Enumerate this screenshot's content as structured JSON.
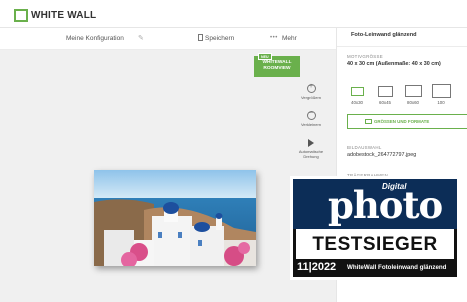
{
  "header": {
    "logo_text": "WHITE WALL"
  },
  "subbar": {
    "configuration_label": "Meine Konfiguration",
    "save_label": "Speichern",
    "more_label": "Mehr"
  },
  "canvas": {
    "roomview_new": "NEU",
    "roomview_line1": "WHITEWALL",
    "roomview_line2": "ROOMVIEW",
    "zoom_in_label": "Vergrößern",
    "zoom_out_label": "Verkleinern",
    "autoplay_line1": "Automatische",
    "autoplay_line2": "Drehung"
  },
  "panel": {
    "product_title": "Foto-Leinwand glänzend",
    "size_section": "MOTIVGRÖSSE",
    "size_value": "40 x 30 cm (Außenmaße: 40 x 30 cm)",
    "sizes": [
      "40x30",
      "60x45",
      "80x60",
      "100"
    ],
    "size_button": "GRÖSSEN UND FORMATE",
    "image_section": "BILDAUSWAHL",
    "image_value": "adobestock_264772797.jpeg",
    "frame_section": "TRÄGERRAHMEN"
  },
  "badge": {
    "digital": "Digital",
    "magazine": "photo",
    "award": "TESTSIEGER",
    "issue": "11|2022",
    "product": "WhiteWall Fotoleinwand glänzend"
  },
  "colors": {
    "accent": "#6ab04c",
    "badge_blue": "#0c2d57"
  }
}
